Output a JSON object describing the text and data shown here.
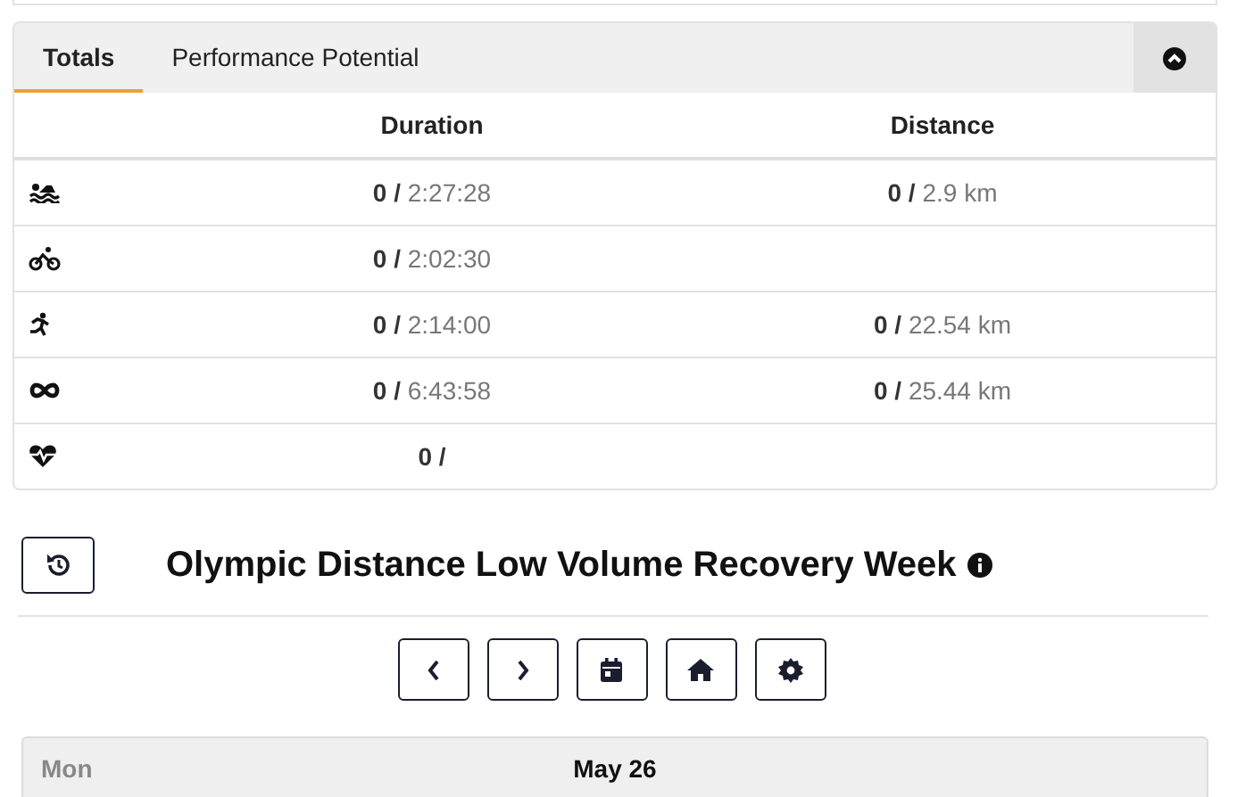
{
  "tabs": [
    {
      "label": "Totals",
      "selected": true
    },
    {
      "label": "Performance Potential",
      "selected": false
    }
  ],
  "table": {
    "columns": [
      "Duration",
      "Distance"
    ],
    "rows": [
      {
        "kind": "swim",
        "duration": {
          "actual": "0 /",
          "planned": "2:27:28"
        },
        "distance": {
          "actual": "0 /",
          "planned": "2.9 km"
        }
      },
      {
        "kind": "bike",
        "duration": {
          "actual": "0 /",
          "planned": "2:02:30"
        }
      },
      {
        "kind": "run",
        "duration": {
          "actual": "0 /",
          "planned": "2:14:00"
        },
        "distance": {
          "actual": "0 /",
          "planned": "22.54 km"
        }
      },
      {
        "kind": "total",
        "duration": {
          "actual": "0 /",
          "planned": "6:43:58"
        },
        "distance": {
          "actual": "0 /",
          "planned": "25.44 km"
        }
      },
      {
        "kind": "heart",
        "duration": {
          "actual": "0 /"
        }
      }
    ]
  },
  "week": {
    "title": "Olympic Distance Low Volume Recovery Week"
  },
  "nav_buttons": [
    {
      "kind": "prev"
    },
    {
      "kind": "next"
    },
    {
      "kind": "calendar"
    },
    {
      "kind": "home"
    },
    {
      "kind": "settings"
    }
  ],
  "day": {
    "weekday": "Mon",
    "date": "May 26"
  }
}
